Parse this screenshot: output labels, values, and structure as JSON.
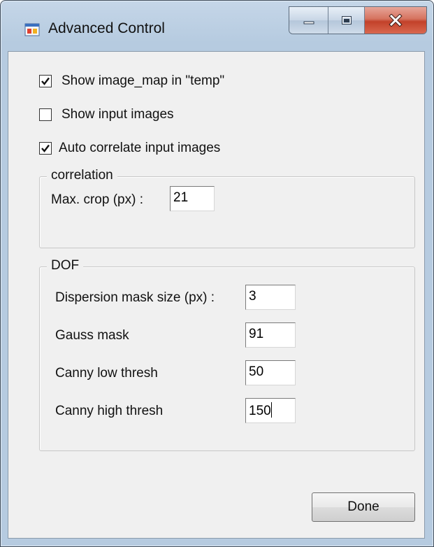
{
  "window": {
    "title": "Advanced Control",
    "icon": "app-window-icon"
  },
  "options": [
    {
      "label": "Show image_map in \"temp\"",
      "checked": true
    },
    {
      "label": "Show input images",
      "checked": false
    },
    {
      "label": "Auto correlate input images",
      "checked": true
    }
  ],
  "correlation": {
    "legend": "correlation",
    "max_crop_label": "Max. crop (px) :",
    "max_crop_value": "21"
  },
  "dof": {
    "legend": "DOF",
    "dispersion_label": "Dispersion mask size (px) :",
    "dispersion_value": "3",
    "gauss_label": "Gauss mask",
    "gauss_value": "91",
    "canny_low_label": "Canny low thresh",
    "canny_low_value": "50",
    "canny_high_label": "Canny high thresh",
    "canny_high_value": "150"
  },
  "buttons": {
    "done_label": "Done"
  }
}
